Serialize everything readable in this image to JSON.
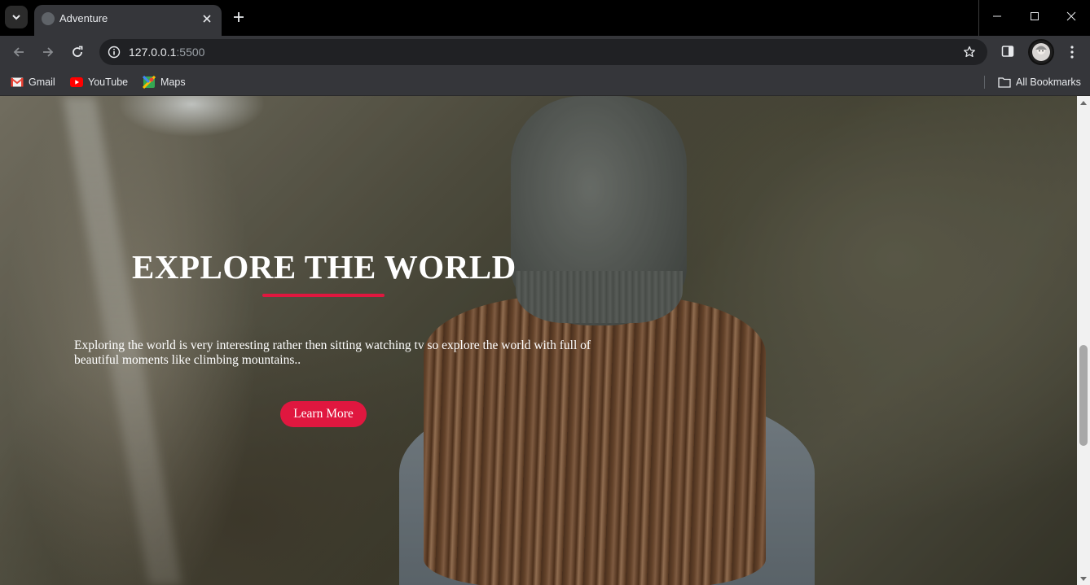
{
  "browser": {
    "tab": {
      "title": "Adventure"
    },
    "omnibox": {
      "host": "127.0.0.1",
      "port": ":5500"
    },
    "bookmarks": [
      {
        "label": "Gmail"
      },
      {
        "label": "YouTube"
      },
      {
        "label": "Maps"
      }
    ],
    "all_bookmarks_label": "All Bookmarks"
  },
  "hero": {
    "title": "EXPLORE THE WORLD",
    "text": "Exploring the world is very interesting rather then sitting watching tv so explore the world with full of beautiful moments like climbing mountains..",
    "button_label": "Learn More"
  },
  "colors": {
    "accent": "#e0173f",
    "chrome_dark": "#000000",
    "toolbar": "#35363a"
  }
}
